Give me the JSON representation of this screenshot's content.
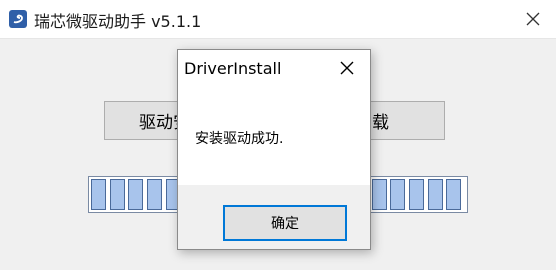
{
  "window": {
    "title": "瑞芯微驱动助手 v5.1.1",
    "icon": "rockchip-app-icon",
    "close_icon": "close-icon"
  },
  "main": {
    "install_button_label": "驱动安",
    "uninstall_button_label": "卸载",
    "progress_segments": 20
  },
  "dialog": {
    "title": "DriverInstall",
    "message": "安装驱动成功.",
    "ok_label": "确定",
    "close_icon": "close-icon"
  },
  "colors": {
    "focus_border": "#0078d7",
    "progress_segment": "#a8c4ec"
  }
}
